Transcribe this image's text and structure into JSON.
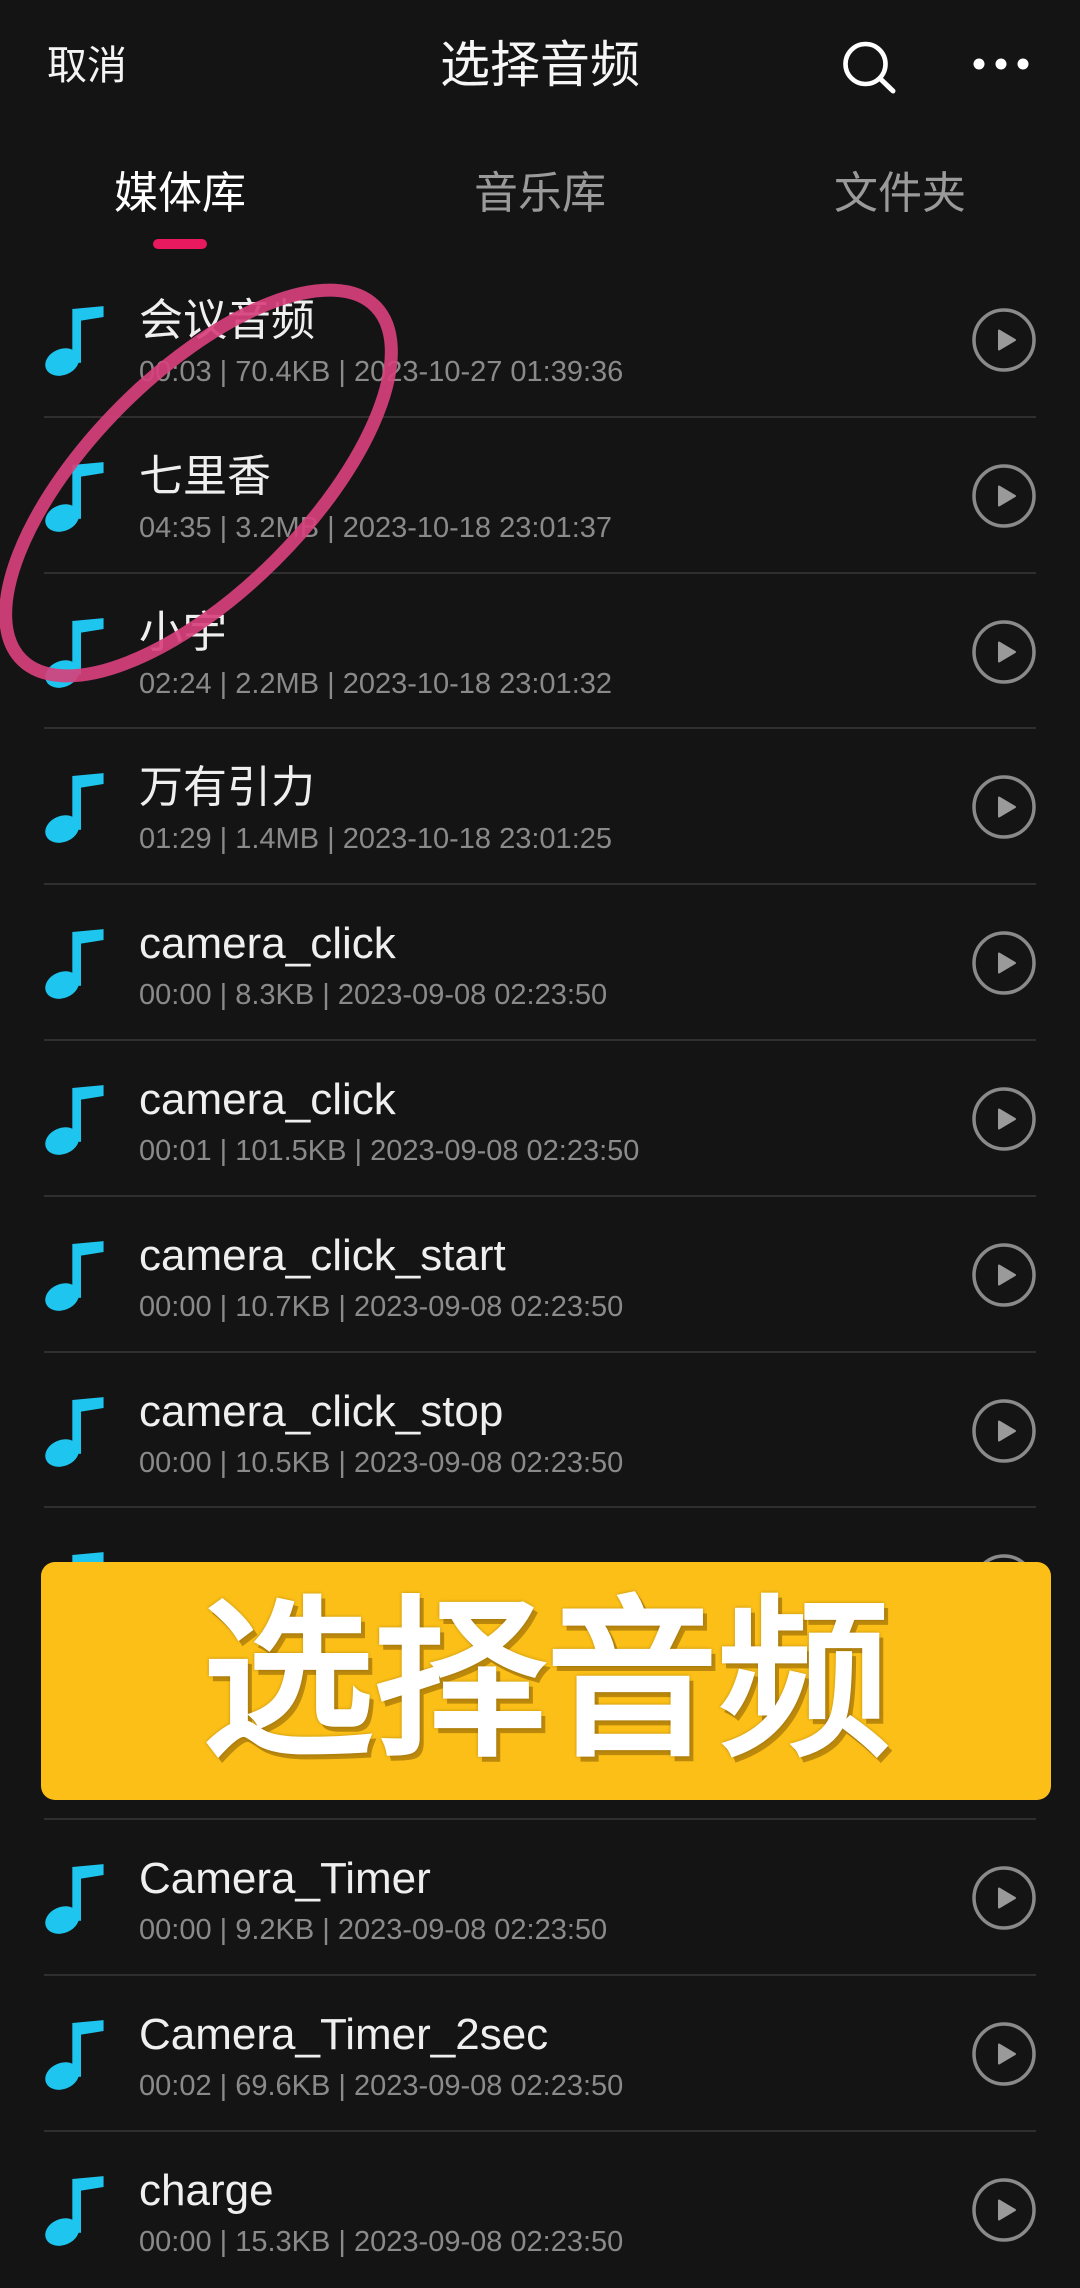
{
  "theme": {
    "background": "#141414",
    "accent": "#E8195E",
    "note_icon": "#1EC6EF",
    "banner": "#FBBF17",
    "annotation": "#D6407C"
  },
  "header": {
    "cancel_label": "取消",
    "title": "选择音频",
    "search_icon": "search-icon",
    "more_icon": "more-options-icon"
  },
  "tabs": [
    {
      "label": "媒体库",
      "active": true
    },
    {
      "label": "音乐库",
      "active": false
    },
    {
      "label": "文件夹",
      "active": false
    }
  ],
  "meta_separator": " | ",
  "list_item_icon": "music-note-icon",
  "list_item_action_icon": "play-icon",
  "audio_list": [
    {
      "title": "会议音频",
      "duration": "00:03",
      "size": "70.4KB",
      "modified": "2023-10-27 01:39:36"
    },
    {
      "title": "七里香",
      "duration": "04:35",
      "size": "3.2MB",
      "modified": "2023-10-18 23:01:37"
    },
    {
      "title": "小宇",
      "duration": "02:24",
      "size": "2.2MB",
      "modified": "2023-10-18 23:01:32"
    },
    {
      "title": "万有引力",
      "duration": "01:29",
      "size": "1.4MB",
      "modified": "2023-10-18 23:01:25"
    },
    {
      "title": "camera_click",
      "duration": "00:00",
      "size": "8.3KB",
      "modified": "2023-09-08 02:23:50"
    },
    {
      "title": "camera_click",
      "duration": "00:01",
      "size": "101.5KB",
      "modified": "2023-09-08 02:23:50"
    },
    {
      "title": "camera_click_start",
      "duration": "00:00",
      "size": "10.7KB",
      "modified": "2023-09-08 02:23:50"
    },
    {
      "title": "camera_click_stop",
      "duration": "00:00",
      "size": "10.5KB",
      "modified": "2023-09-08 02:23:50"
    },
    {
      "obscured": true
    },
    {
      "obscured": true
    },
    {
      "title": "Camera_Timer",
      "duration": "00:00",
      "size": "9.2KB",
      "modified": "2023-09-08 02:23:50"
    },
    {
      "title": "Camera_Timer_2sec",
      "duration": "00:02",
      "size": "69.6KB",
      "modified": "2023-09-08 02:23:50"
    },
    {
      "title": "charge",
      "duration": "00:00",
      "size": "15.3KB",
      "modified": "2023-09-08 02:23:50"
    }
  ],
  "overlay": {
    "banner_text": "选择音频"
  }
}
